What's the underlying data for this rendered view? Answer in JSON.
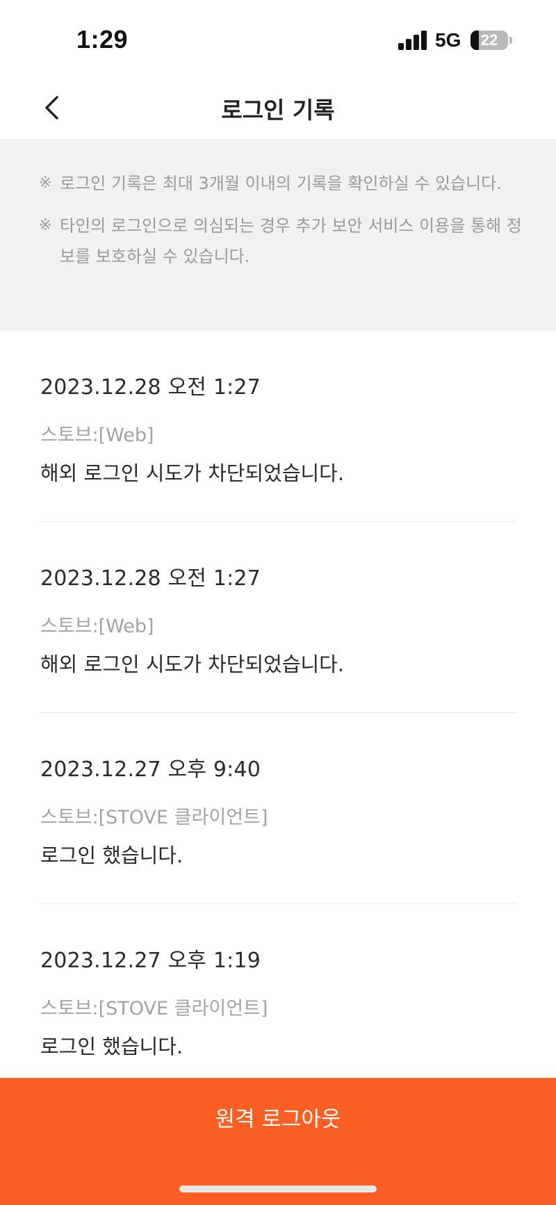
{
  "status_bar": {
    "time": "1:29",
    "network": "5G",
    "battery_level": "22",
    "battery_fraction": 0.22,
    "icons": [
      "signal-icon",
      "battery-icon"
    ]
  },
  "header": {
    "back_icon": "chevron-left-icon",
    "title": "로그인 기록"
  },
  "notice": {
    "mark": "※",
    "items": [
      "로그인 기록은 최대 3개월 이내의 기록을 확인하실 수 있습니다.",
      "타인의 로그인으로 의심되는 경우 추가 보안 서비스 이용을 통해 정보를 보호하실 수 있습니다."
    ]
  },
  "records": [
    {
      "datetime": "2023.12.28 오전 1:27",
      "platform": "스토브:[Web]",
      "message": "해외 로그인 시도가 차단되었습니다."
    },
    {
      "datetime": "2023.12.28 오전 1:27",
      "platform": "스토브:[Web]",
      "message": "해외 로그인 시도가 차단되었습니다."
    },
    {
      "datetime": "2023.12.27 오후 9:40",
      "platform": "스토브:[STOVE 클라이언트]",
      "message": "로그인 했습니다."
    },
    {
      "datetime": "2023.12.27 오후 1:19",
      "platform": "스토브:[STOVE 클라이언트]",
      "message": "로그인 했습니다."
    }
  ],
  "footer": {
    "logout_label": "원격 로그아웃"
  },
  "colors": {
    "accent": "#fb5f23",
    "notice_bg": "#f1f1f1",
    "muted_text": "#9a9a9a"
  }
}
